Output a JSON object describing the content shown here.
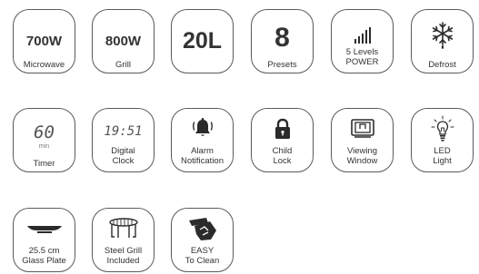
{
  "features": [
    {
      "value": "700W",
      "label": "Microwave"
    },
    {
      "value": "800W",
      "label": "Grill"
    },
    {
      "value": "20L",
      "label": ""
    },
    {
      "value": "8",
      "label": "Presets"
    },
    {
      "label_lines": [
        "5 Levels",
        "POWER"
      ],
      "icon": "power-levels-icon"
    },
    {
      "label": "Defrost",
      "icon": "snowflake-icon"
    },
    {
      "display": "60",
      "unit": "min",
      "label": "Timer"
    },
    {
      "display": "19:51",
      "label_lines": [
        "Digital",
        "Clock"
      ]
    },
    {
      "label_lines": [
        "Alarm",
        "Notification"
      ],
      "icon": "bell-icon"
    },
    {
      "label_lines": [
        "Child",
        "Lock"
      ],
      "icon": "padlock-icon"
    },
    {
      "label_lines": [
        "Viewing",
        "Window"
      ],
      "icon": "viewing-window-icon"
    },
    {
      "label_lines": [
        "LED",
        "Light"
      ],
      "icon": "light-bulb-icon"
    },
    {
      "label_lines": [
        "25.5 cm",
        "Glass Plate"
      ],
      "icon": "glass-plate-icon"
    },
    {
      "label_lines": [
        "Steel Grill",
        "Included"
      ],
      "icon": "steel-grill-icon"
    },
    {
      "label_lines": [
        "EASY",
        "To Clean"
      ],
      "icon": "cleaning-cloth-icon"
    }
  ],
  "colors": {
    "border": "#5a5a5a",
    "text": "#333333",
    "icon": "#2b2b2b"
  }
}
